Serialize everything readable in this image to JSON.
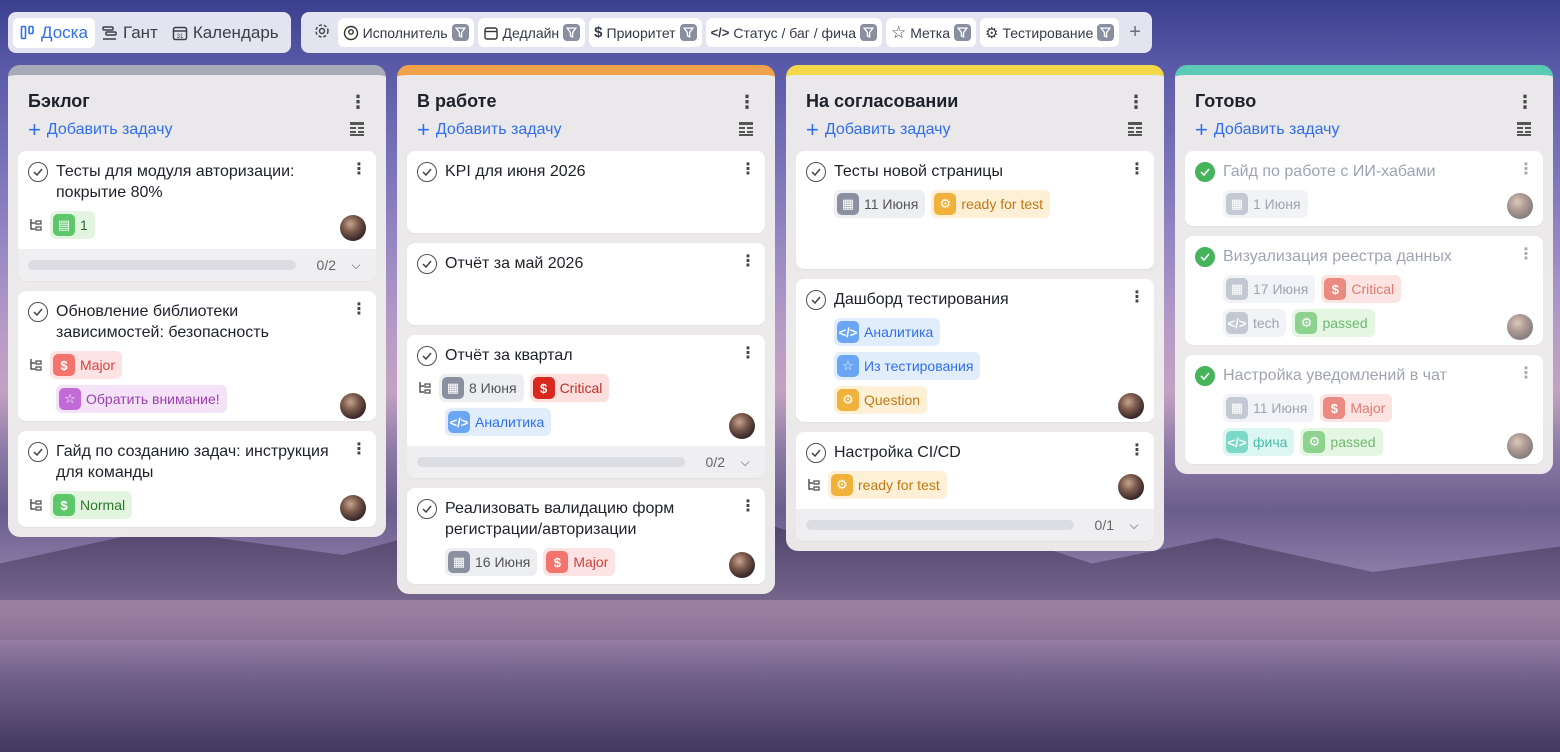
{
  "views": [
    "Доска",
    "Гант",
    "Календарь"
  ],
  "filters": [
    "Исполнитель",
    "Дедлайн",
    "Приоритет",
    "Статус / баг / фича",
    "Метка",
    "Тестирование"
  ],
  "add_label": "Добавить задачу",
  "columns": [
    {
      "title": "Бэклог",
      "color": "#a9aab8",
      "cards": [
        {
          "title": "Тесты для модуля авторизации: покрытие 80%",
          "comments": "1",
          "progress": "0/2"
        },
        {
          "title": "Обновление библиотеки зависимостей: безопасность",
          "priority": "Major",
          "label": "Обратить внимание!"
        },
        {
          "title": "Гайд по созданию задач: инструкция для команды",
          "priority": "Normal"
        }
      ]
    },
    {
      "title": "В работе",
      "color": "#f0a24a",
      "cards": [
        {
          "title": "KPI для июня 2026"
        },
        {
          "title": "Отчёт за май 2026"
        },
        {
          "title": "Отчёт за квартал",
          "date": "8 Июня",
          "priority": "Critical",
          "type": "Аналитика",
          "progress": "0/2"
        },
        {
          "title": "Реализовать валидацию форм регистрации/авторизации",
          "date": "16 Июня",
          "priority": "Major"
        }
      ]
    },
    {
      "title": "На согласовании",
      "color": "#f3d84a",
      "cards": [
        {
          "title": "Тесты новой страницы",
          "date": "11 Июня",
          "testing": "ready for test"
        },
        {
          "title": "Дашборд тестирования",
          "type": "Аналитика",
          "label": "Из тестирования",
          "testing": "Question"
        },
        {
          "title": "Настройка CI/CD",
          "testing": "ready for test",
          "progress": "0/1"
        }
      ]
    },
    {
      "title": "Готово",
      "color": "#5ccbb6",
      "cards": [
        {
          "title": "Гайд по работе с ИИ-хабами",
          "date": "1 Июня"
        },
        {
          "title": "Визуализация реестра данных",
          "date": "17 Июня",
          "priority": "Critical",
          "type": "tech",
          "testing": "passed"
        },
        {
          "title": "Настройка уведомлений в чат",
          "date": "11 Июня",
          "priority": "Major",
          "type": "фича",
          "testing": "passed"
        }
      ]
    }
  ]
}
